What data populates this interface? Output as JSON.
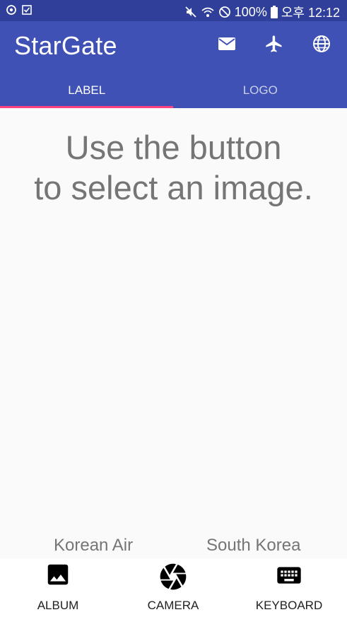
{
  "status_bar": {
    "left_icons": [
      "sync-icon",
      "checklist-icon"
    ],
    "right_icons": [
      "mute-icon",
      "wifi-icon",
      "blocked-icon",
      "battery-icon"
    ],
    "battery": "100%",
    "time": "오후 12:12"
  },
  "app_bar": {
    "title": "StarGate",
    "actions": [
      "mail-icon",
      "airplane-icon",
      "globe-icon"
    ],
    "background": "#3f51b5",
    "status_background": "#2f3f9a"
  },
  "tabs": [
    {
      "label": "LABEL",
      "selected": true
    },
    {
      "label": "LOGO",
      "selected": false
    }
  ],
  "tab_indicator_color": "#ff4081",
  "main": {
    "prompt_line1": "Use the button",
    "prompt_line2": "to select an image."
  },
  "results": {
    "left": "Korean Air",
    "right": "South Korea"
  },
  "bottom_nav": [
    {
      "label": "ALBUM",
      "icon": "image-icon"
    },
    {
      "label": "CAMERA",
      "icon": "camera-shutter-icon"
    },
    {
      "label": "KEYBOARD",
      "icon": "keyboard-icon"
    }
  ]
}
